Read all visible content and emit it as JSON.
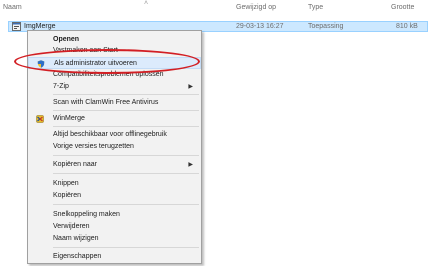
{
  "header": {
    "name": "Naam",
    "modified": "Gewijzigd op",
    "type": "Type",
    "size": "Grootte"
  },
  "file": {
    "name": "ImgMerge",
    "modified": "29-03-13 16:27",
    "type": "Toepassing",
    "size": "810 kB",
    "icon": "application-icon"
  },
  "menu": {
    "items": [
      {
        "id": "open",
        "label": "Openen"
      },
      {
        "id": "pin-start",
        "label": "Vastmaken aan Start"
      },
      {
        "id": "run-as-admin",
        "label": "Als administrator uitvoeren",
        "icon": "shield-icon"
      },
      {
        "id": "compat",
        "label": "Compatibiliteitsproblemen oplossen"
      },
      {
        "id": "7zip",
        "label": "7-Zip"
      },
      {
        "id": "clamwin",
        "label": "Scan with ClamWin Free Antivirus"
      },
      {
        "id": "winmerge",
        "label": "WinMerge",
        "icon": "winmerge-icon"
      },
      {
        "id": "offline",
        "label": "Altijd beschikbaar voor offlinegebruik"
      },
      {
        "id": "prev-versions",
        "label": "Vorige versies terugzetten"
      },
      {
        "id": "copy-to",
        "label": "Kopiëren naar"
      },
      {
        "id": "cut",
        "label": "Knippen"
      },
      {
        "id": "copy",
        "label": "Kopiëren"
      },
      {
        "id": "shortcut",
        "label": "Snelkoppeling maken"
      },
      {
        "id": "delete",
        "label": "Verwijderen"
      },
      {
        "id": "rename",
        "label": "Naam wijzigen"
      },
      {
        "id": "properties",
        "label": "Eigenschappen"
      }
    ]
  },
  "colors": {
    "selection": "#cce8ff",
    "hover": "#dcebfc",
    "annotation": "#d21e23"
  }
}
